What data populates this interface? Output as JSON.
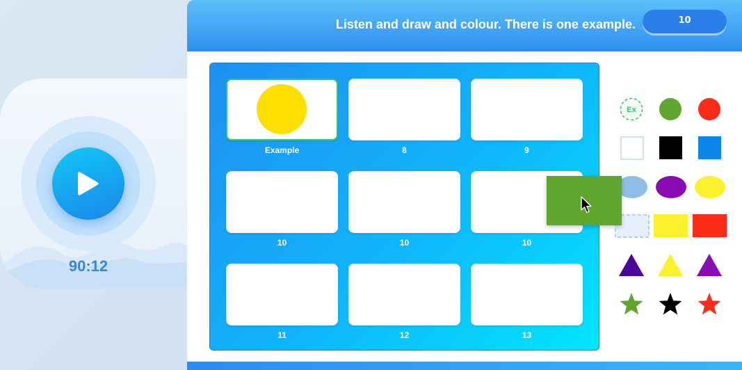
{
  "header": {
    "instruction": "Listen and draw and colour. There is one example.",
    "score": "10"
  },
  "player": {
    "timer": "90:12",
    "play_icon": "play-icon"
  },
  "board": {
    "cells": [
      {
        "label": "Example",
        "content": "yellow-circle"
      },
      {
        "label": "8"
      },
      {
        "label": "9"
      },
      {
        "label": "10"
      },
      {
        "label": "10"
      },
      {
        "label": "10"
      },
      {
        "label": "11"
      },
      {
        "label": "12"
      },
      {
        "label": "13"
      }
    ]
  },
  "palette": {
    "example_badge": "Ex",
    "colors": {
      "green": "#5ea62d",
      "red": "#fb2d18",
      "black": "#000000",
      "blue": "#0b87ec",
      "light_blue": "#8fbde8",
      "purple": "#8a0ab4",
      "yellow": "#fdf02c",
      "indigo": "#4a0599",
      "yellow_example": "#ffdf00"
    },
    "rows": [
      [
        "example-badge",
        "green-circle",
        "red-circle"
      ],
      [
        "white-square",
        "black-square",
        "blue-square"
      ],
      [
        "light-blue-oval",
        "purple-oval",
        "yellow-oval"
      ],
      [
        "empty-rectangle-slot",
        "yellow-rectangle",
        "red-rectangle"
      ],
      [
        "indigo-triangle",
        "yellow-triangle",
        "purple-triangle"
      ],
      [
        "green-star",
        "black-star",
        "red-star"
      ]
    ]
  },
  "drag": {
    "tile": "green-rectangle-tile",
    "cursor": "mouse-pointer-icon"
  }
}
